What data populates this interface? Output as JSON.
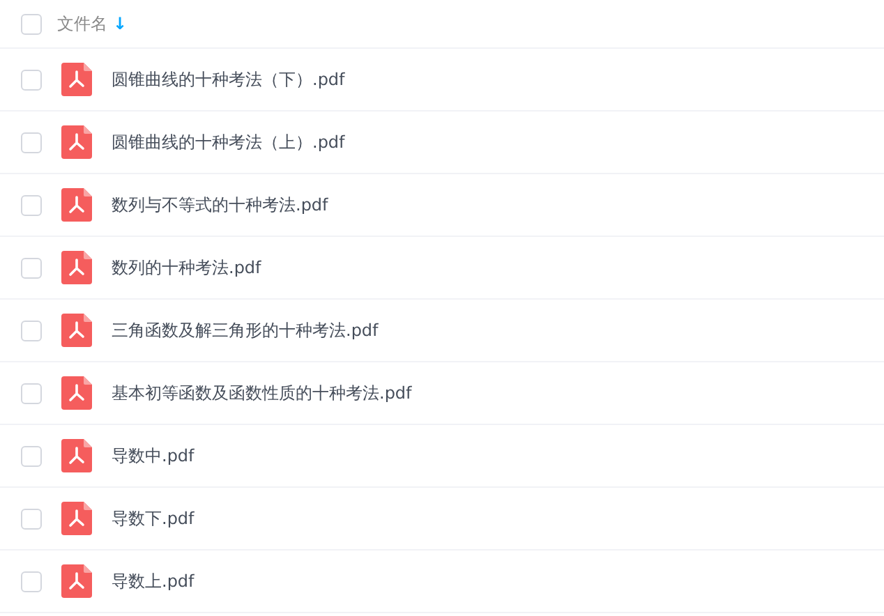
{
  "header": {
    "checked": false,
    "column_label": "文件名",
    "sort_icon": "↓"
  },
  "files": [
    {
      "name": "圆锥曲线的十种考法（下）.pdf",
      "checked": false
    },
    {
      "name": "圆锥曲线的十种考法（上）.pdf",
      "checked": false
    },
    {
      "name": "数列与不等式的十种考法.pdf",
      "checked": false
    },
    {
      "name": "数列的十种考法.pdf",
      "checked": false
    },
    {
      "name": "三角函数及解三角形的十种考法.pdf",
      "checked": false
    },
    {
      "name": "基本初等函数及函数性质的十种考法.pdf",
      "checked": false
    },
    {
      "name": "导数中.pdf",
      "checked": false
    },
    {
      "name": "导数下.pdf",
      "checked": false
    },
    {
      "name": "导数上.pdf",
      "checked": false
    }
  ]
}
